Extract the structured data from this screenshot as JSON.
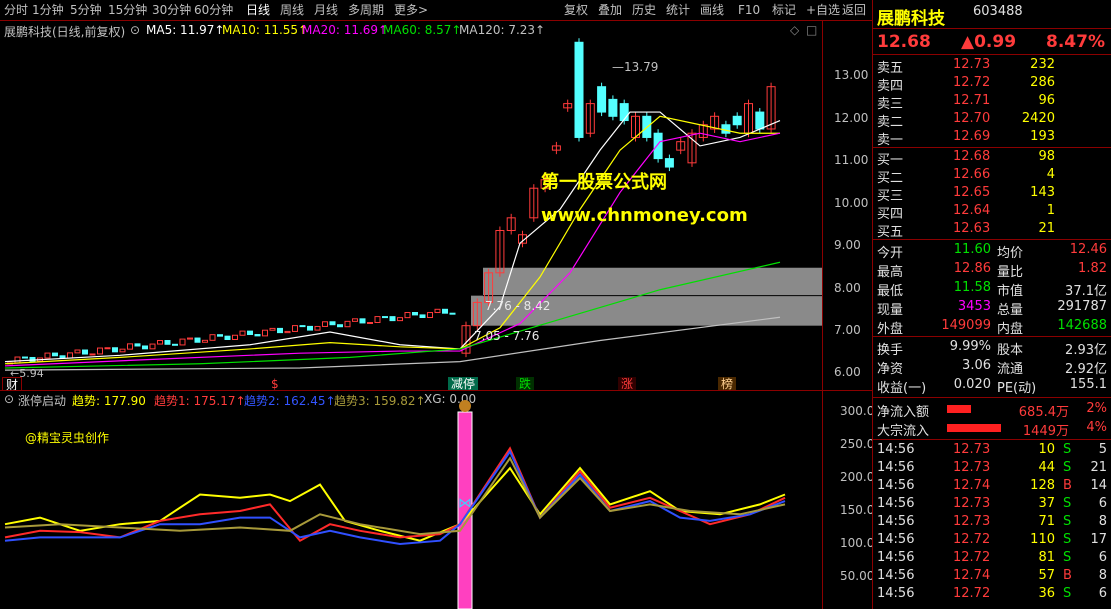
{
  "toolbar": {
    "left": [
      "分时",
      "1分钟",
      "5分钟",
      "15分钟",
      "30分钟",
      "60分钟",
      "日线",
      "周线",
      "月线",
      "多周期",
      "更多>"
    ],
    "right": [
      "复权",
      "叠加",
      "历史",
      "统计",
      "画线",
      "F10",
      "标记",
      "+自选",
      "返回"
    ]
  },
  "info": {
    "title": "展鹏科技(日线,前复权)",
    "ma5": "MA5: 11.97↑",
    "ma10": "MA10: 11.55↑",
    "ma20": "MA20: 11.69↑",
    "ma60": "MA60: 8.57↑",
    "ma120": "MA120: 7.23↑"
  },
  "main_axis": [
    "13.00",
    "12.00",
    "11.00",
    "10.00",
    "9.00",
    "8.00",
    "7.00",
    "6.00"
  ],
  "annotations": {
    "high": "13.79",
    "low": "5.94",
    "zone1": "7.76 - 8.42",
    "zone2": "7.05 - 7.76",
    "wm1": "第一股票公式网",
    "wm2": "www.chnmoney.com",
    "credit": "@精宝灵虫创作"
  },
  "tags": [
    "财",
    "$",
    "减停",
    "跌",
    "涨",
    "榜"
  ],
  "indicator": {
    "name": "涨停启动",
    "t1": "趋势: 177.90",
    "t2": "趋势1: 175.17↑",
    "t3": "趋势2: 162.45↑",
    "t4": "趋势3: 159.82↑",
    "xg": "XG: 0.00"
  },
  "ind_axis": [
    "300.0",
    "250.0",
    "200.0",
    "150.0",
    "100.0",
    "50.00"
  ],
  "stock": {
    "name": "展鹏科技",
    "code": "603488",
    "price": "12.68",
    "change": "▲0.99",
    "pct": "8.47%"
  },
  "asks": [
    {
      "l": "卖五",
      "p": "12.73",
      "v": "232"
    },
    {
      "l": "卖四",
      "p": "12.72",
      "v": "286"
    },
    {
      "l": "卖三",
      "p": "12.71",
      "v": "96"
    },
    {
      "l": "卖二",
      "p": "12.70",
      "v": "2420"
    },
    {
      "l": "卖一",
      "p": "12.69",
      "v": "193"
    }
  ],
  "bids": [
    {
      "l": "买一",
      "p": "12.68",
      "v": "98"
    },
    {
      "l": "买二",
      "p": "12.66",
      "v": "4"
    },
    {
      "l": "买三",
      "p": "12.65",
      "v": "143"
    },
    {
      "l": "买四",
      "p": "12.64",
      "v": "1"
    },
    {
      "l": "买五",
      "p": "12.63",
      "v": "21"
    }
  ],
  "stats": [
    {
      "a": "今开",
      "av": "11.60",
      "ac": "green",
      "b": "均价",
      "bv": "12.46",
      "bc": "red"
    },
    {
      "a": "最高",
      "av": "12.86",
      "ac": "red",
      "b": "量比",
      "bv": "1.82",
      "bc": "red"
    },
    {
      "a": "最低",
      "av": "11.58",
      "ac": "green",
      "b": "市值",
      "bv": "37.1亿",
      "bc": "white"
    },
    {
      "a": "现量",
      "av": "3453",
      "ac": "mag",
      "b": "总量",
      "bv": "291787",
      "bc": "white"
    },
    {
      "a": "外盘",
      "av": "149099",
      "ac": "red",
      "b": "内盘",
      "bv": "142688",
      "bc": "green"
    }
  ],
  "stats2": [
    {
      "a": "换手",
      "av": "9.99%",
      "b": "股本",
      "bv": "2.93亿"
    },
    {
      "a": "净资",
      "av": "3.06",
      "b": "流通",
      "bv": "2.92亿"
    },
    {
      "a": "收益(一)",
      "av": "0.020",
      "b": "PE(动)",
      "bv": "155.1"
    }
  ],
  "flows": [
    {
      "l": "净流入额",
      "v": "685.4万",
      "p": "2%"
    },
    {
      "l": "大宗流入",
      "v": "1449万",
      "p": "4%"
    }
  ],
  "ticks": [
    {
      "t": "14:56",
      "p": "12.73",
      "v": "10",
      "s": "S",
      "n": "5"
    },
    {
      "t": "14:56",
      "p": "12.73",
      "v": "44",
      "s": "S",
      "n": "21"
    },
    {
      "t": "14:56",
      "p": "12.74",
      "v": "128",
      "s": "B",
      "n": "14"
    },
    {
      "t": "14:56",
      "p": "12.73",
      "v": "37",
      "s": "S",
      "n": "6"
    },
    {
      "t": "14:56",
      "p": "12.73",
      "v": "71",
      "s": "S",
      "n": "8"
    },
    {
      "t": "14:56",
      "p": "12.72",
      "v": "110",
      "s": "S",
      "n": "17"
    },
    {
      "t": "14:56",
      "p": "12.72",
      "v": "81",
      "s": "S",
      "n": "6"
    },
    {
      "t": "14:56",
      "p": "12.74",
      "v": "57",
      "s": "B",
      "n": "8"
    },
    {
      "t": "14:56",
      "p": "12.72",
      "v": "36",
      "s": "S",
      "n": "6"
    }
  ],
  "colors": {
    "up": "#ff3b3b",
    "down": "#54ffff",
    "ma5": "#ffffff",
    "ma10": "#ffff00",
    "ma20": "#ff00ff",
    "ma60": "#00e000",
    "ma120": "#c0c0c0"
  }
}
